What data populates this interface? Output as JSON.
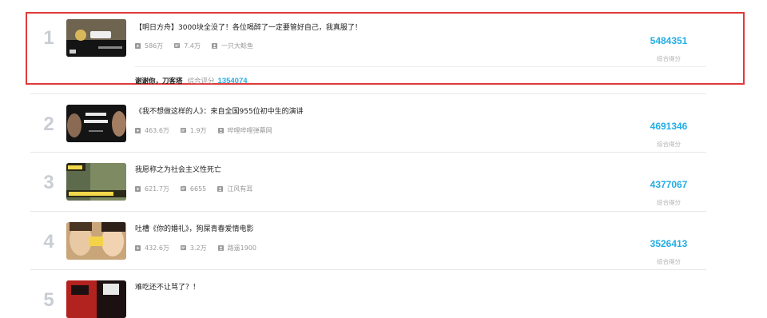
{
  "accent_color": "#23ade5",
  "highlight_color": "#e03a3a",
  "items": [
    {
      "rank": "1",
      "title": "【明日方舟】3000块全没了！各位喝醉了一定要管好自己，我真服了！",
      "plays": "586万",
      "danmaku": "7.4万",
      "author": "一只大鲶鱼",
      "score": "5484351",
      "score_label": "综合得分",
      "extra": {
        "text": "谢谢你，刀客塔",
        "label": "综合评分",
        "value": "1354074"
      }
    },
    {
      "rank": "2",
      "title": "《我不想做这样的人》：来自全国955位初中生的演讲",
      "plays": "463.6万",
      "danmaku": "1.9万",
      "author": "哔哩哔哩弹幕网",
      "score": "4691346",
      "score_label": "综合得分"
    },
    {
      "rank": "3",
      "title": "我愿称之为社会主义性死亡",
      "plays": "621.7万",
      "danmaku": "6655",
      "author": "江风有耳",
      "score": "4377067",
      "score_label": "综合得分"
    },
    {
      "rank": "4",
      "title": "吐槽《你的婚礼》，狗屎青春爱情电影",
      "plays": "432.6万",
      "danmaku": "3.2万",
      "author": "路遥1900",
      "score": "3526413",
      "score_label": "综合得分"
    },
    {
      "rank": "5",
      "title": "难吃还不让骂了？！"
    }
  ]
}
